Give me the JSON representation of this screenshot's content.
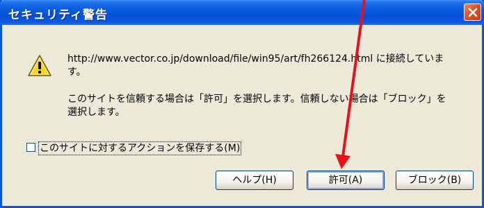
{
  "window": {
    "title": "セキュリティ警告",
    "close_icon": "close-icon"
  },
  "message": {
    "icon": "warning-icon",
    "line1": "http://www.vector.co.jp/download/file/win95/art/fh266124.html に接続していま",
    "line2": "す。",
    "line3": "このサイトを信頼する場合は「許可」を選択します。信頼しない場合は「ブロック」を",
    "line4": "選択します。"
  },
  "option": {
    "checked": false,
    "label": "このサイトに対するアクションを保存する(M)"
  },
  "buttons": {
    "help": "ヘルプ(H)",
    "allow": "許可(A)",
    "block": "ブロック(B)"
  },
  "colors": {
    "titlebar": "#0a5ee0",
    "dialog_bg": "#ece9d8",
    "close_button": "#d9542b",
    "annotation_arrow": "#e8101a"
  }
}
